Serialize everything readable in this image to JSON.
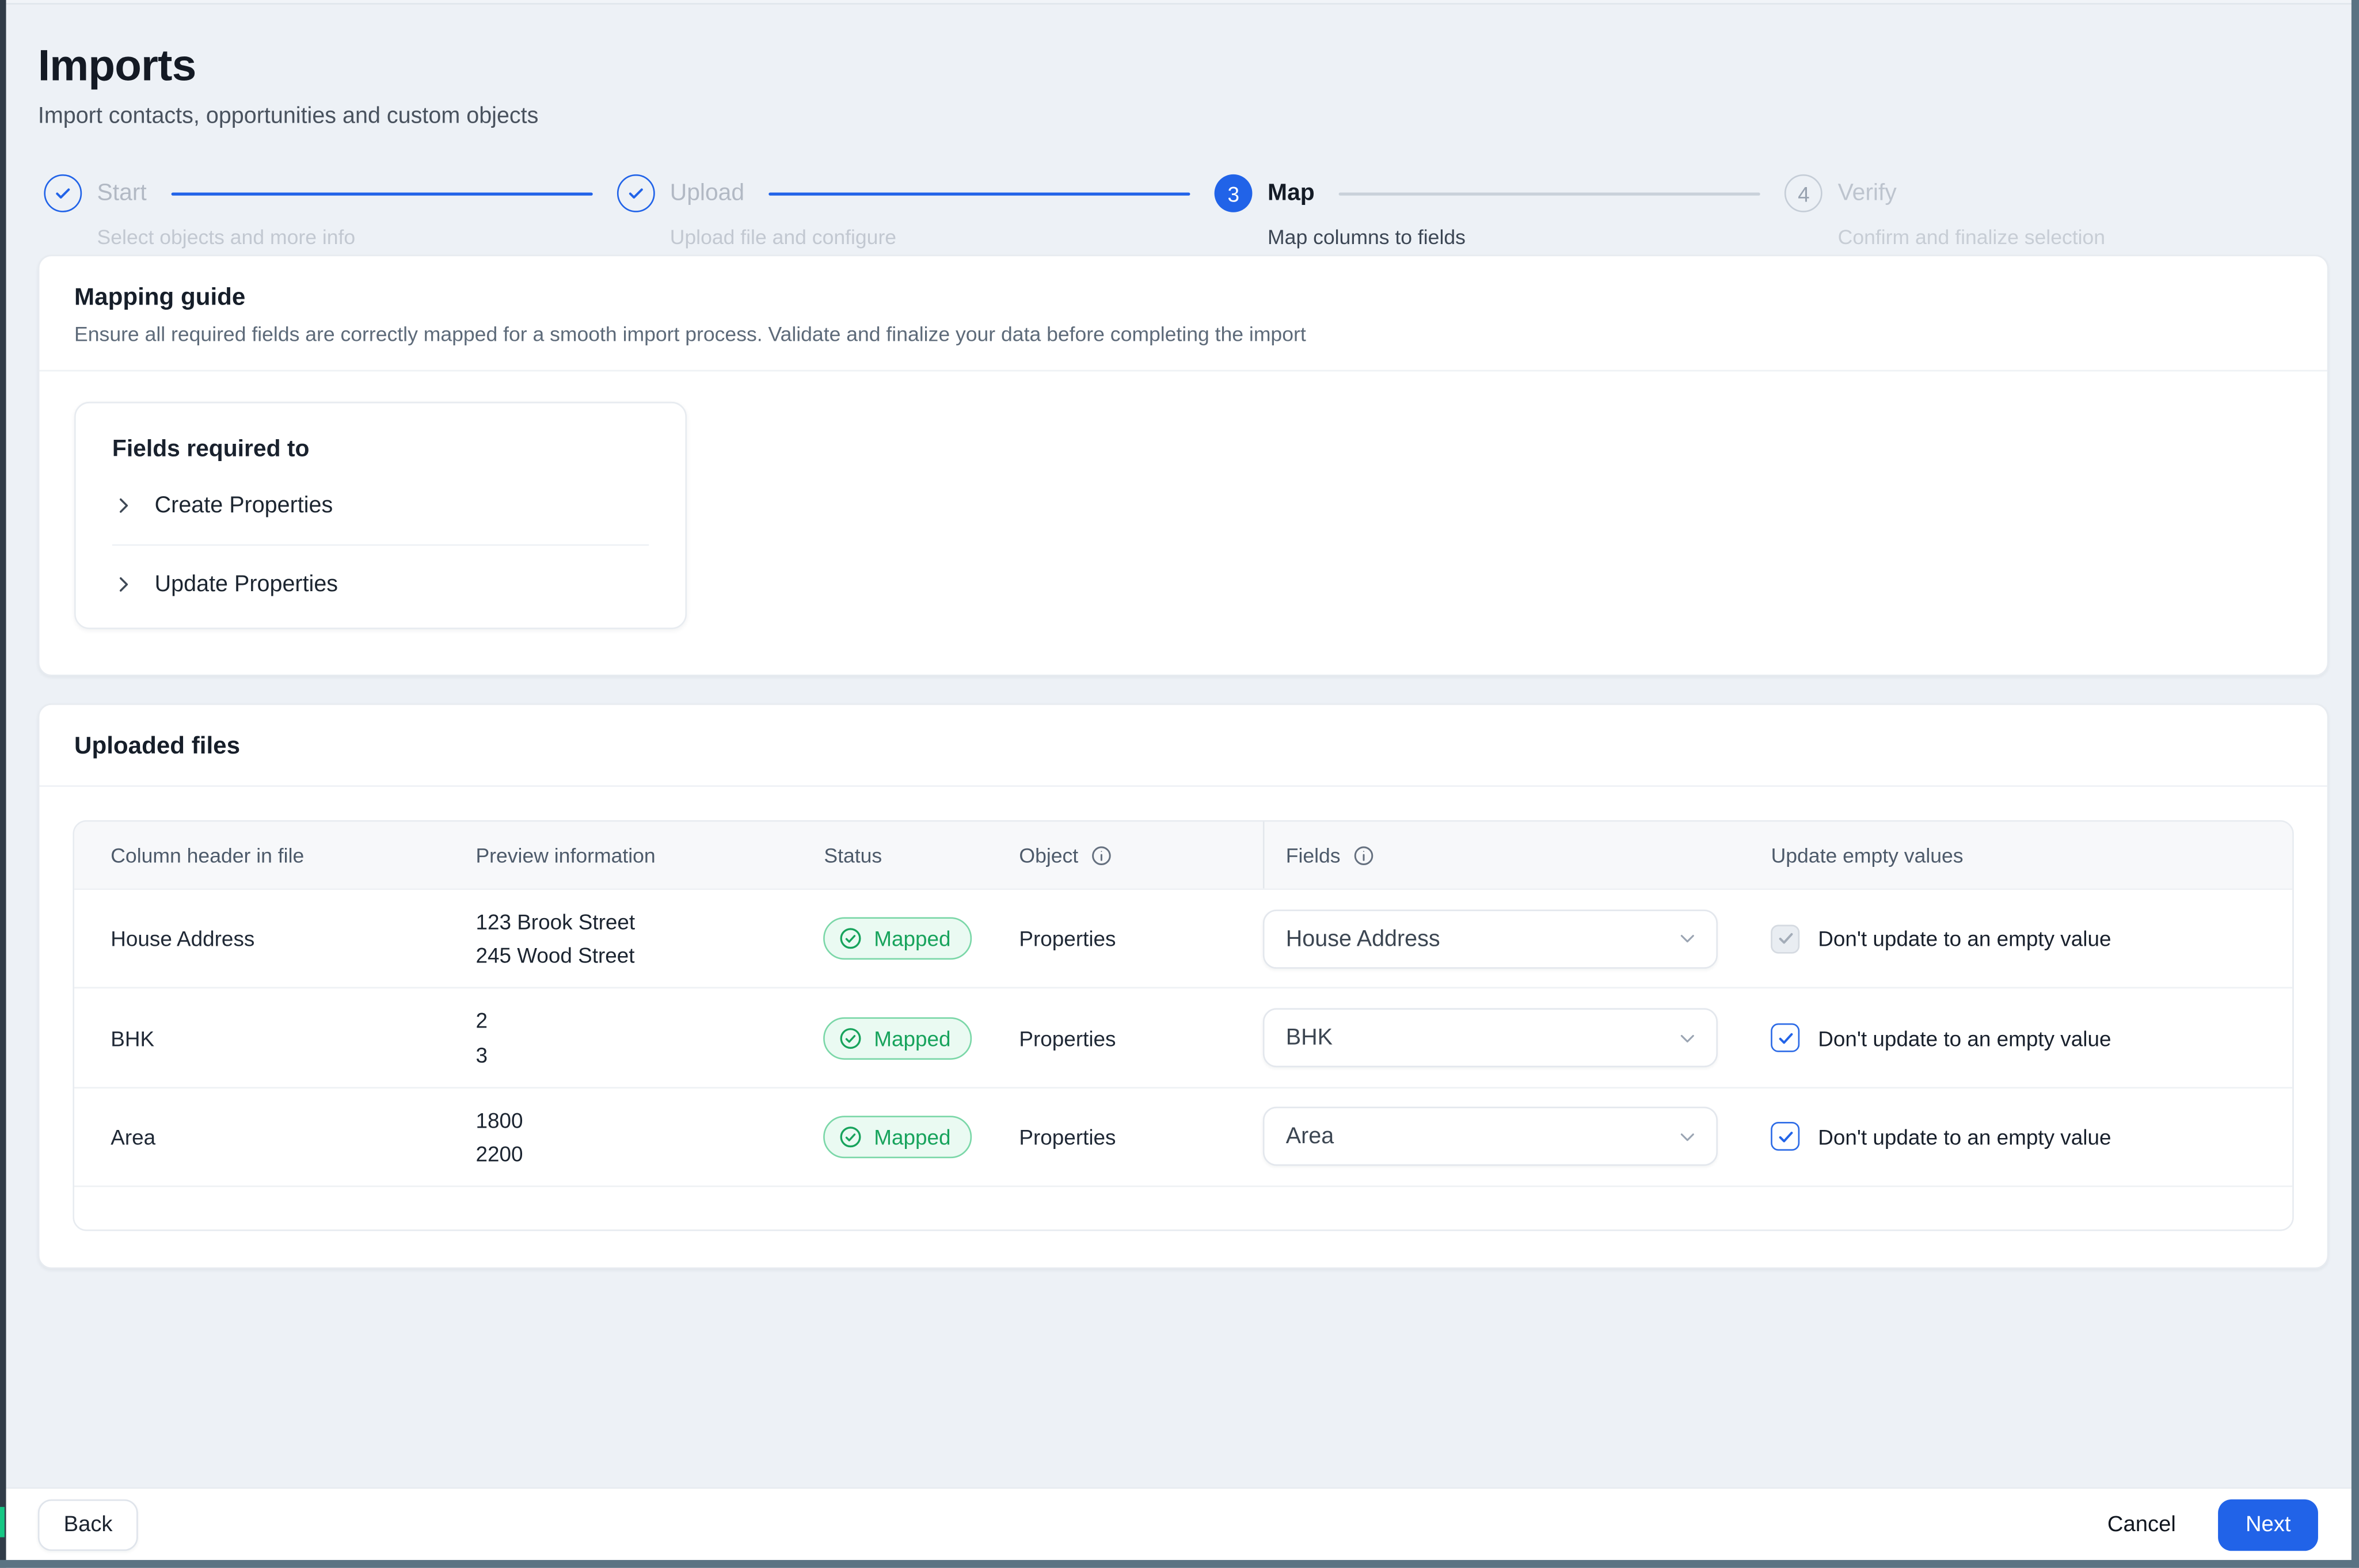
{
  "colors": {
    "accent": "#2163e8",
    "success": "#17a35c",
    "success_bg": "#eafaf2",
    "success_border": "#7bd7a8",
    "page_bg": "#edf1f6",
    "frame": "#5b7383",
    "frame_left": "#313c48",
    "card_border": "#e7ebf0"
  },
  "page": {
    "title": "Imports",
    "subtitle": "Import contacts, opportunities and custom objects"
  },
  "stepper": {
    "steps": [
      {
        "number": "1",
        "label": "Start",
        "sublabel": "Select objects and more info",
        "state": "complete",
        "connector_to_next": "blue"
      },
      {
        "number": "2",
        "label": "Upload",
        "sublabel": "Upload file and configure",
        "state": "complete",
        "connector_to_next": "blue"
      },
      {
        "number": "3",
        "label": "Map",
        "sublabel": "Map columns to fields",
        "state": "active",
        "connector_to_next": "gray"
      },
      {
        "number": "4",
        "label": "Verify",
        "sublabel": "Confirm and finalize selection",
        "state": "upcoming"
      }
    ]
  },
  "mapping_guide": {
    "title": "Mapping guide",
    "description": "Ensure all required fields are correctly mapped for a smooth import process. Validate and finalize your data before completing the import",
    "panel_title": "Fields required to",
    "items": [
      {
        "label": "Create Properties"
      },
      {
        "label": "Update Properties"
      }
    ]
  },
  "uploaded_files": {
    "title": "Uploaded files",
    "table": {
      "headers": [
        {
          "label": "Column header in file"
        },
        {
          "label": "Preview information"
        },
        {
          "label": "Status"
        },
        {
          "label": "Object",
          "info": true
        },
        {
          "label": "Fields",
          "info": true,
          "divider": true
        },
        {
          "label": "Update empty values"
        }
      ],
      "rows": [
        {
          "column_header": "House Address",
          "preview": [
            "123 Brook Street",
            "245 Wood Street"
          ],
          "status": "Mapped",
          "object": "Properties",
          "field": "House Address",
          "checkbox": {
            "label": "Don't update to an empty value",
            "checked": true,
            "disabled": true
          }
        },
        {
          "column_header": "BHK",
          "preview": [
            "2",
            "3"
          ],
          "status": "Mapped",
          "object": "Properties",
          "field": "BHK",
          "checkbox": {
            "label": "Don't update to an empty value",
            "checked": true,
            "disabled": false
          }
        },
        {
          "column_header": "Area",
          "preview": [
            "1800",
            "2200"
          ],
          "status": "Mapped",
          "object": "Properties",
          "field": "Area",
          "checkbox": {
            "label": "Don't update to an empty value",
            "checked": true,
            "disabled": false
          }
        }
      ]
    }
  },
  "footer": {
    "back_label": "Back",
    "cancel_label": "Cancel",
    "next_label": "Next"
  }
}
